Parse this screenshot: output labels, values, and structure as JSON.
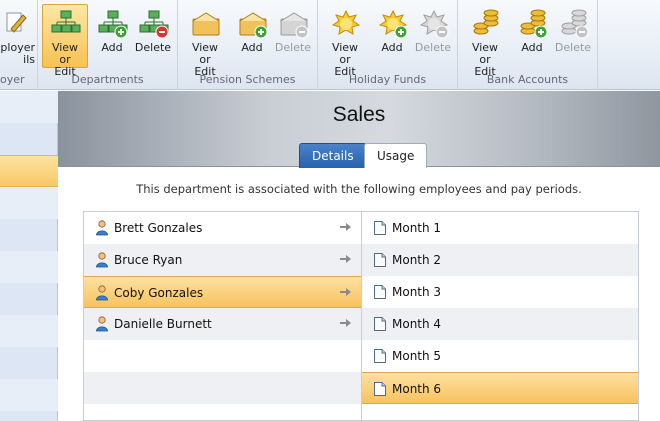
{
  "ribbon": {
    "left_group": {
      "label": "oyer",
      "button_label": "ployer\nils"
    },
    "groups": [
      {
        "name": "departments",
        "label": "Departments",
        "buttons": [
          {
            "label": "View or Edit",
            "state": "active"
          },
          {
            "label": "Add",
            "state": "enabled"
          },
          {
            "label": "Delete",
            "state": "enabled"
          }
        ]
      },
      {
        "name": "pension-schemes",
        "label": "Pension Schemes",
        "buttons": [
          {
            "label": "View or Edit",
            "state": "enabled"
          },
          {
            "label": "Add",
            "state": "enabled"
          },
          {
            "label": "Delete",
            "state": "disabled"
          }
        ]
      },
      {
        "name": "holiday-funds",
        "label": "Holiday Funds",
        "buttons": [
          {
            "label": "View or Edit",
            "state": "enabled"
          },
          {
            "label": "Add",
            "state": "enabled"
          },
          {
            "label": "Delete",
            "state": "disabled"
          }
        ]
      },
      {
        "name": "bank-accounts",
        "label": "Bank Accounts",
        "buttons": [
          {
            "label": "View or Edit",
            "state": "enabled"
          },
          {
            "label": "Add",
            "state": "enabled"
          },
          {
            "label": "Delete",
            "state": "disabled"
          }
        ]
      }
    ]
  },
  "page": {
    "title": "Sales",
    "tabs": {
      "details": "Details",
      "usage": "Usage"
    },
    "description": "This department is associated with the following employees and pay periods."
  },
  "employees": [
    {
      "name": "Brett Gonzales",
      "selected": false
    },
    {
      "name": "Bruce Ryan",
      "selected": false
    },
    {
      "name": "Coby Gonzales",
      "selected": true
    },
    {
      "name": "Danielle Burnett",
      "selected": false
    }
  ],
  "periods": [
    {
      "name": "Month 1",
      "selected": false
    },
    {
      "name": "Month 2",
      "selected": false
    },
    {
      "name": "Month 3",
      "selected": false
    },
    {
      "name": "Month 4",
      "selected": false
    },
    {
      "name": "Month 5",
      "selected": false
    },
    {
      "name": "Month 6",
      "selected": true
    }
  ],
  "colors": {
    "accent": "#2861ad",
    "selection": "#f7c35f",
    "ribbon": "#e8eef6"
  }
}
